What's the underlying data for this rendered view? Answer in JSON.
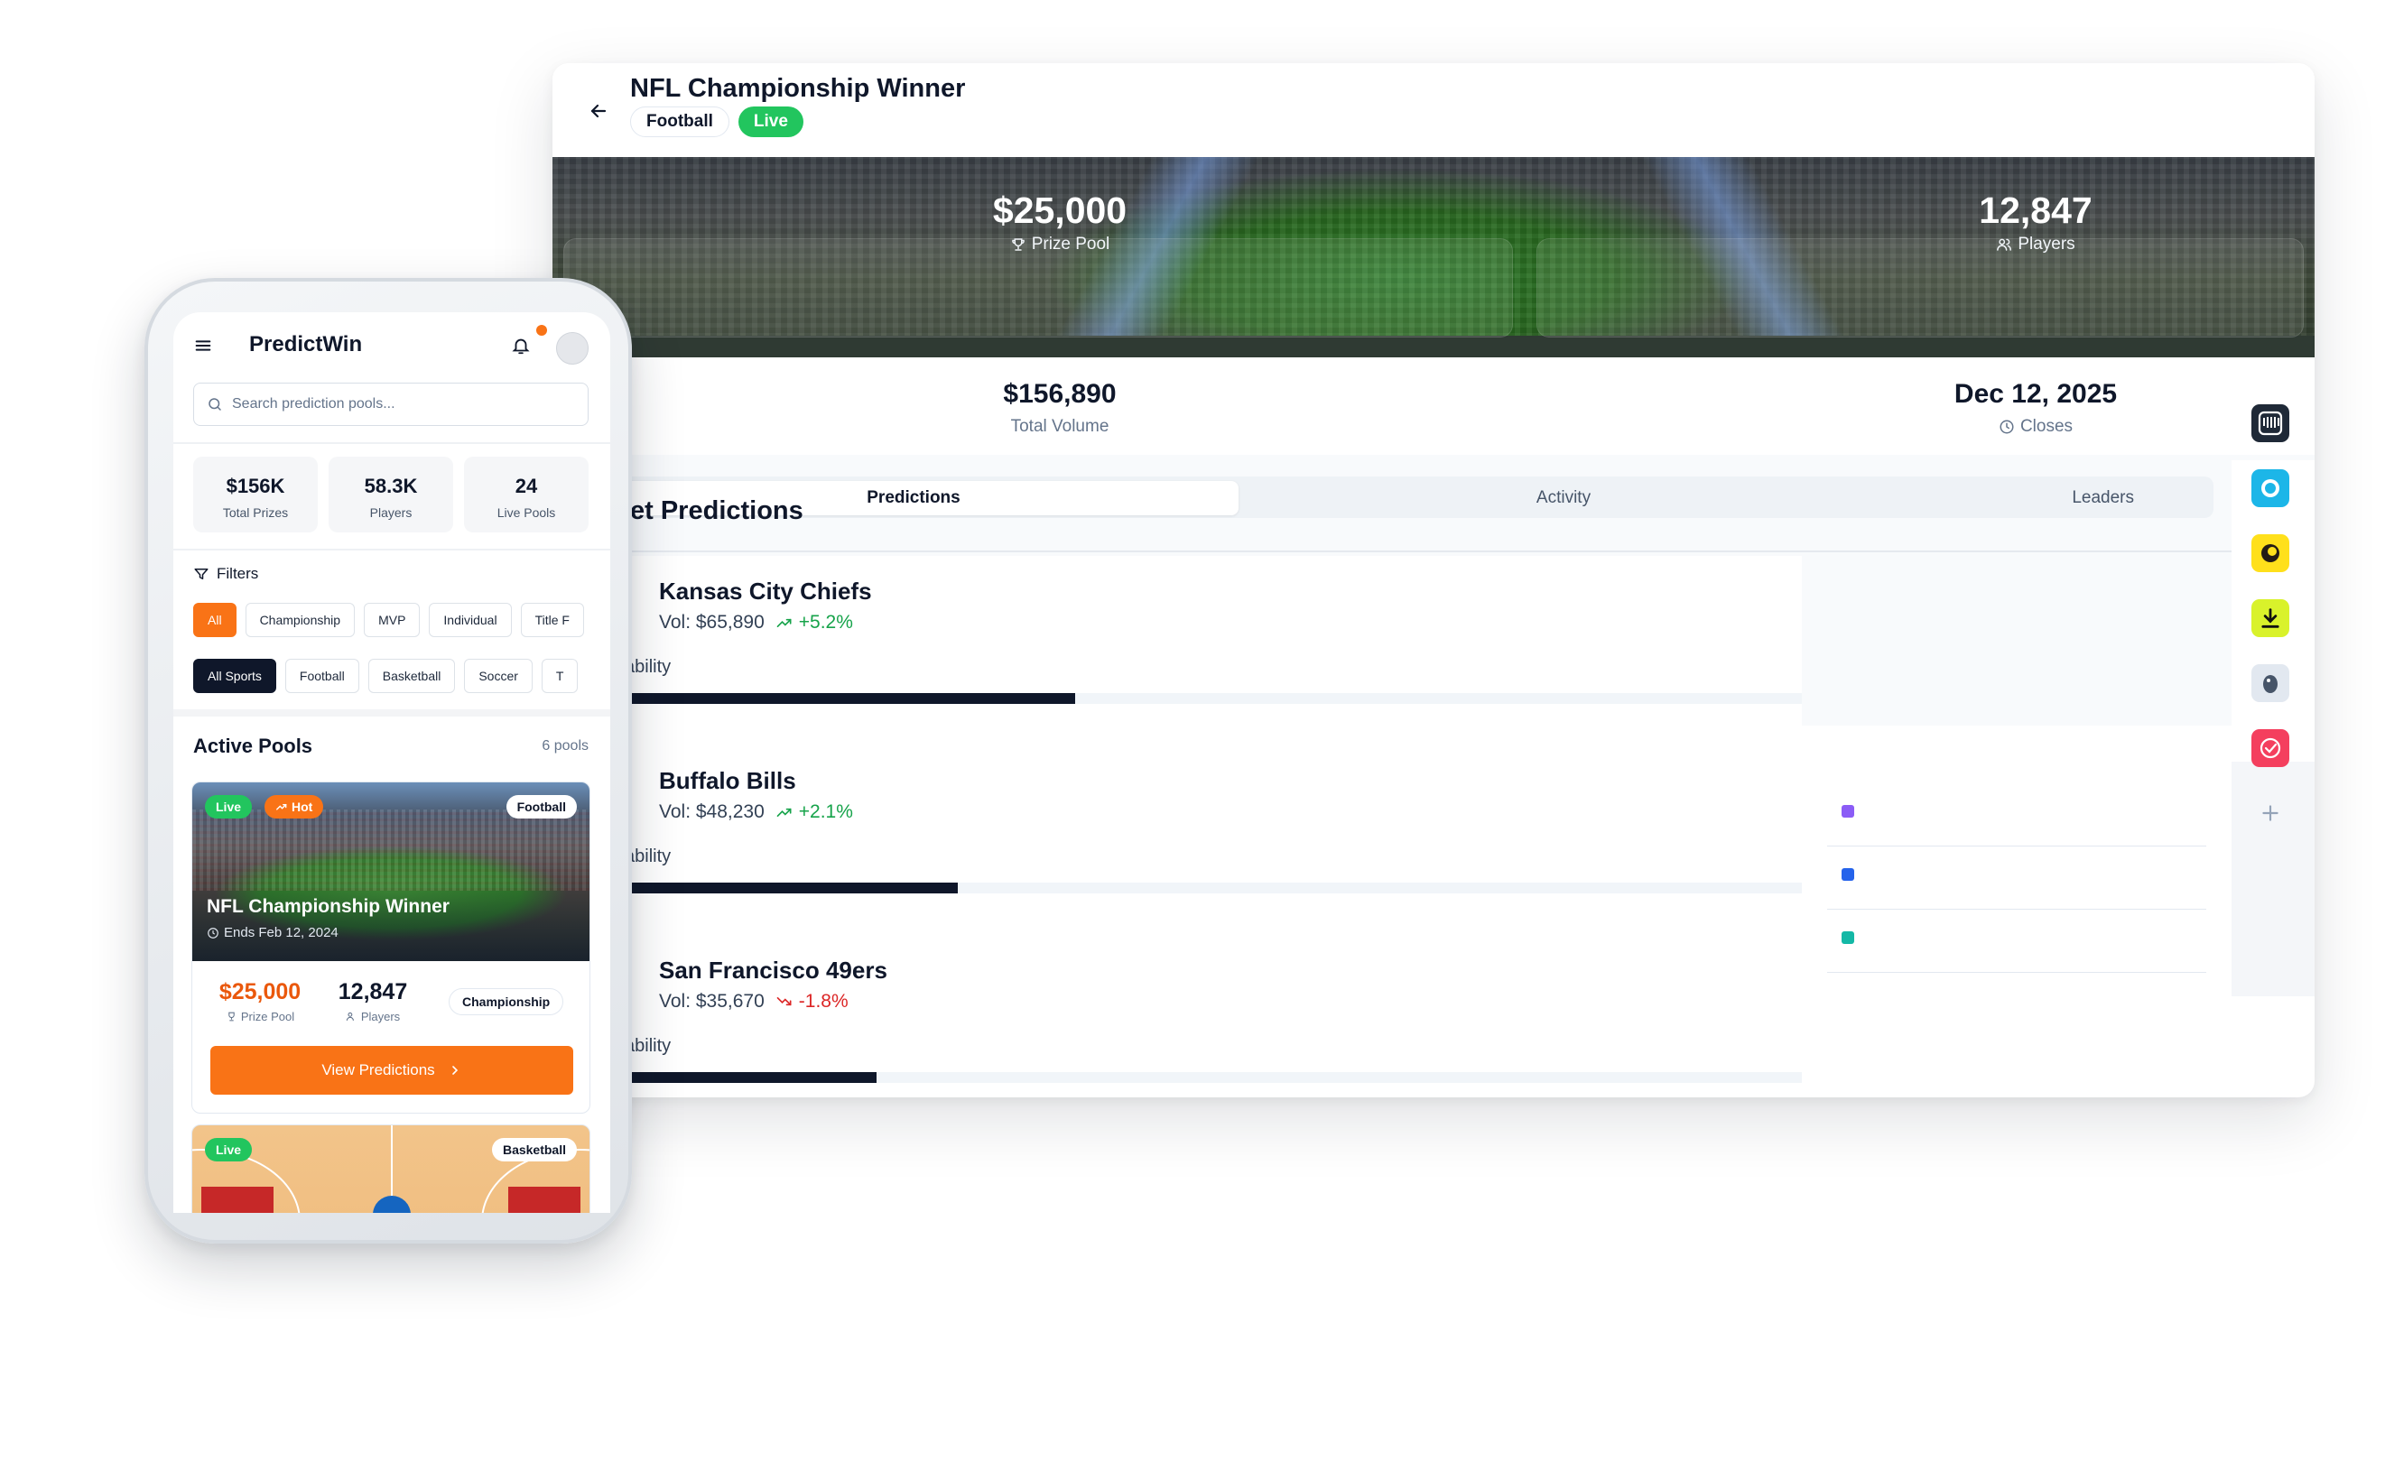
{
  "desktop": {
    "title": "NFL Championship Winner",
    "tags": {
      "sport": "Football",
      "status": "Live"
    },
    "hero_stats": [
      {
        "value": "$25,000",
        "label": "Prize Pool",
        "icon": "trophy-icon"
      },
      {
        "value": "12,847",
        "label": "Players",
        "icon": "users-icon"
      }
    ],
    "secondary_stats": [
      {
        "value": "$156,890",
        "label": "Total Volume"
      },
      {
        "value": "Dec 12, 2025",
        "label": "Closes",
        "icon": "clock-icon"
      }
    ],
    "tabs": [
      "Predictions",
      "Activity",
      "Leaders"
    ],
    "active_tab": "Predictions",
    "section_title": "et Predictions",
    "probability_label": "ability",
    "teams": [
      {
        "name": "Kansas City Chiefs",
        "volume": "Vol: $65,890",
        "change": "+5.2%",
        "direction": "up",
        "probability_fraction": 0.38
      },
      {
        "name": "Buffalo Bills",
        "volume": "Vol: $48,230",
        "change": "+2.1%",
        "direction": "up",
        "probability_fraction": 0.28
      },
      {
        "name": "San Francisco 49ers",
        "volume": "Vol: $35,670",
        "change": "-1.8%",
        "direction": "down",
        "probability_fraction": 0.21
      }
    ],
    "legend_colors": [
      "#8b5cf6",
      "#2563eb",
      "#14b8a6"
    ],
    "rail_apps": [
      "intercom-icon",
      "webex-icon",
      "mailchimp-icon",
      "download-icon",
      "evernote-icon",
      "todo-check-icon",
      "add-icon"
    ]
  },
  "mobile": {
    "brand": "PredictWin",
    "search_placeholder": "Search prediction pools...",
    "kpis": [
      {
        "value": "$156K",
        "label": "Total Prizes"
      },
      {
        "value": "58.3K",
        "label": "Players"
      },
      {
        "value": "24",
        "label": "Live Pools"
      }
    ],
    "filters_label": "Filters",
    "category_chips": [
      "All",
      "Championship",
      "MVP",
      "Individual",
      "Title F"
    ],
    "sport_chips": [
      "All Sports",
      "Football",
      "Basketball",
      "Soccer",
      "T"
    ],
    "pools_title": "Active Pools",
    "pools_count": "6 pools",
    "pool_card": {
      "badge_live": "Live",
      "badge_hot": "Hot",
      "sport": "Football",
      "title": "NFL Championship Winner",
      "ends": "Ends Feb 12, 2024",
      "prize": "$25,000",
      "prize_label": "Prize Pool",
      "players": "12,847",
      "players_label": "Players",
      "category": "Championship",
      "cta": "View Predictions"
    },
    "pool_card2": {
      "badge_live": "Live",
      "sport": "Basketball"
    }
  },
  "colors": {
    "accent": "#f97316",
    "live": "#22c55e",
    "up": "#16a34a",
    "down": "#dc2626",
    "ink": "#0f172a"
  }
}
